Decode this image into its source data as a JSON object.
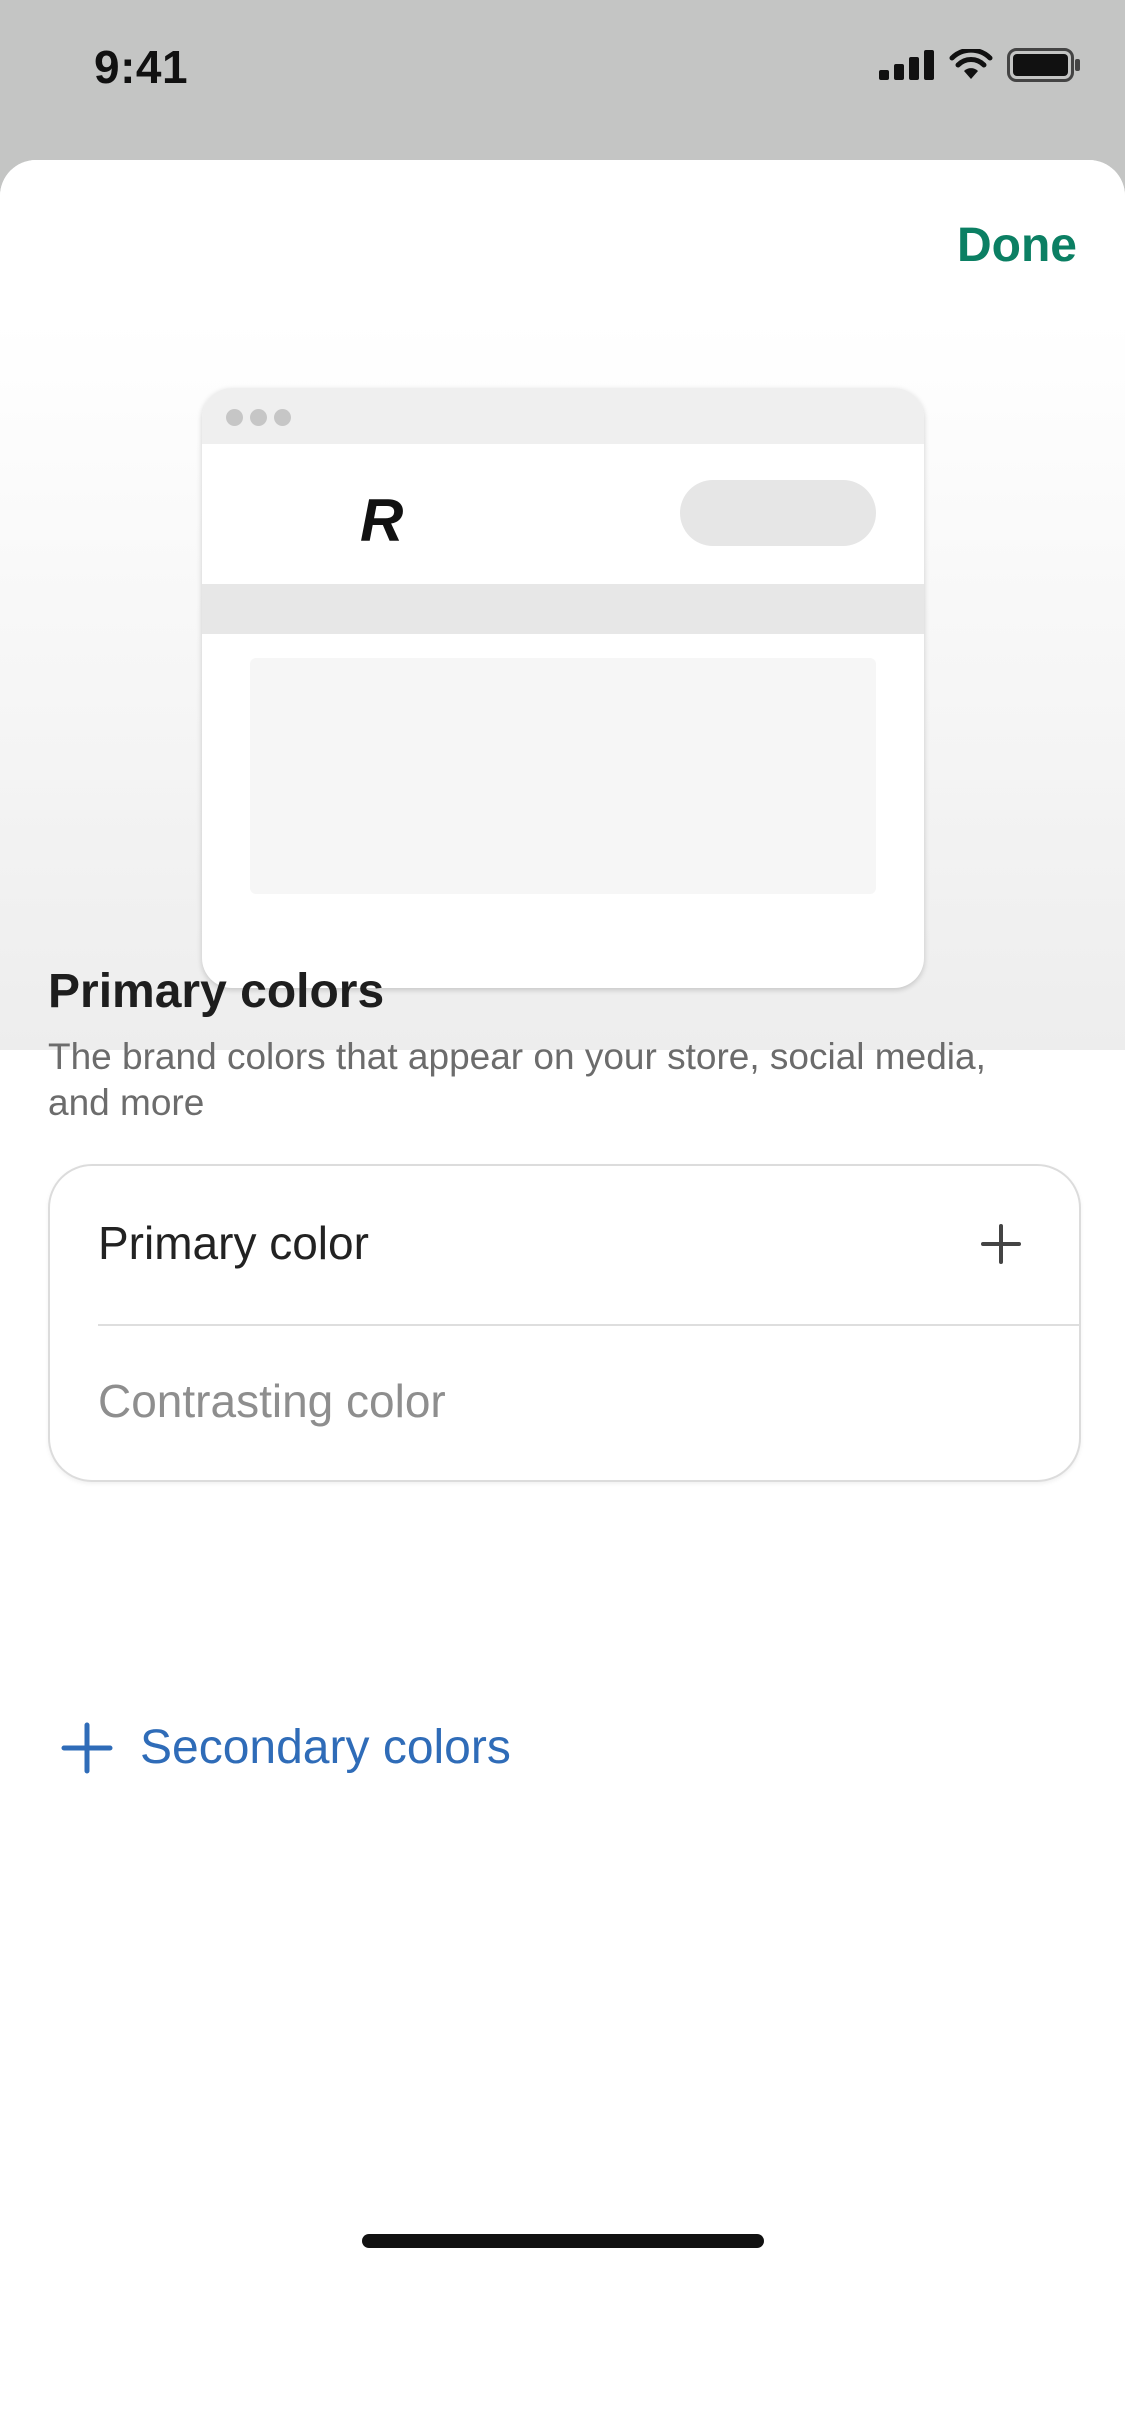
{
  "status_bar": {
    "time": "9:41",
    "icons": [
      "cellular-signal-icon",
      "wifi-icon",
      "battery-icon"
    ]
  },
  "sheet": {
    "done_label": "Done",
    "preview": {
      "logo_letter": "R"
    },
    "primary_colors": {
      "title": "Primary colors",
      "description": "The brand colors that appear on your store, social media, and more",
      "rows": [
        {
          "label": "Primary color",
          "icon": "plus-icon"
        },
        {
          "label": "Contrasting color"
        }
      ]
    },
    "secondary_colors": {
      "label": "Secondary colors",
      "icon": "plus-icon"
    }
  },
  "colors": {
    "accent_done": "#0b7f63",
    "link_blue": "#2f6cb8"
  }
}
